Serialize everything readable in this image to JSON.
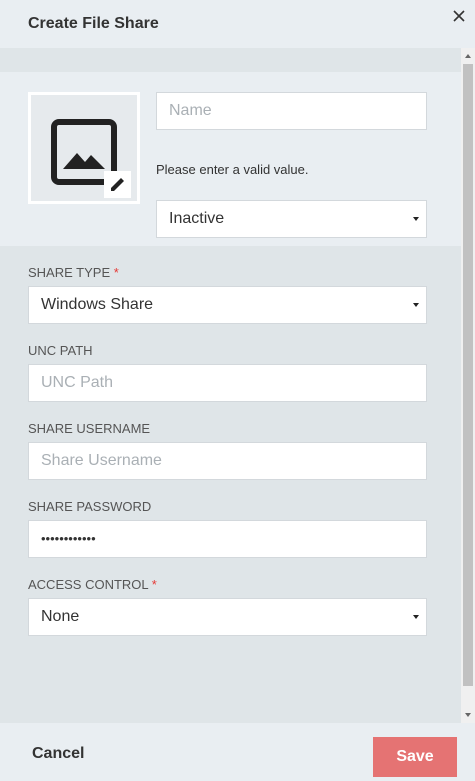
{
  "dialog": {
    "title": "Create File Share"
  },
  "identity": {
    "name_placeholder": "Name",
    "name_hint": "Please enter a valid value.",
    "status_value": "Inactive"
  },
  "fields": {
    "share_type": {
      "label": "SHARE TYPE",
      "required": "*",
      "value": "Windows Share"
    },
    "unc_path": {
      "label": "UNC PATH",
      "placeholder": "UNC Path"
    },
    "share_username": {
      "label": "SHARE USERNAME",
      "placeholder": "Share Username"
    },
    "share_password": {
      "label": "SHARE PASSWORD",
      "value": "••••••••••••"
    },
    "access_control": {
      "label": "ACCESS CONTROL",
      "required": "*",
      "value": "None"
    }
  },
  "footer": {
    "cancel_label": "Cancel",
    "save_label": "Save"
  },
  "colors": {
    "accent_save": "#e57373",
    "required": "#e53935"
  }
}
